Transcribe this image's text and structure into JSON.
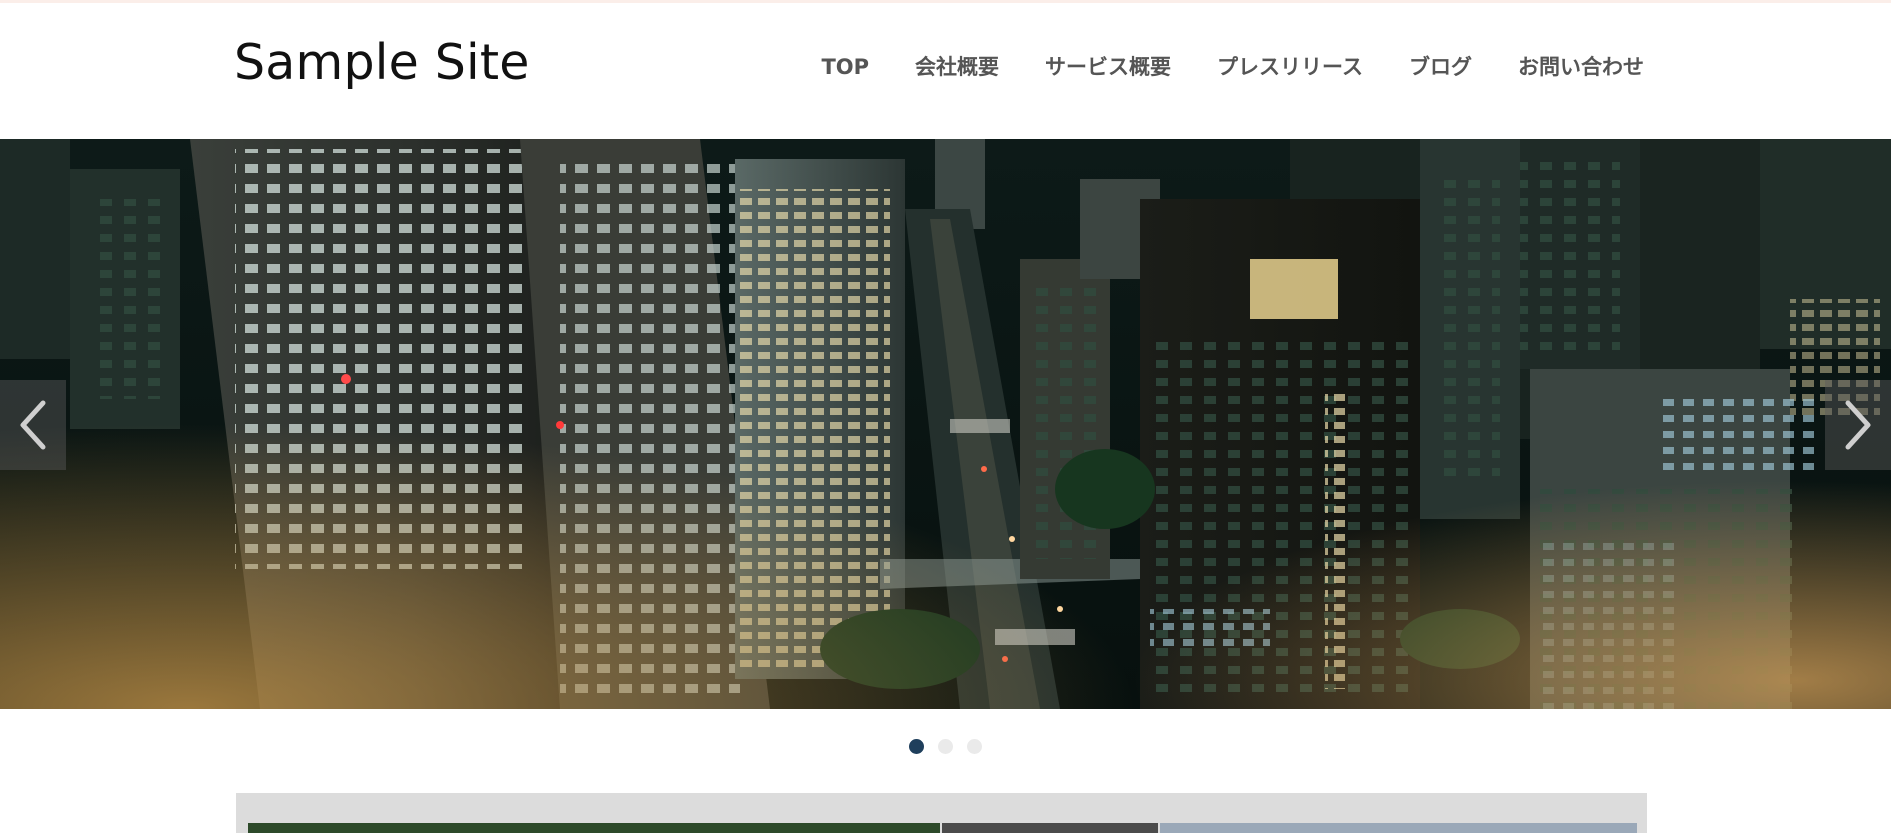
{
  "site": {
    "title": "Sample Site"
  },
  "nav": {
    "items": [
      {
        "label": "TOP"
      },
      {
        "label": "会社概要"
      },
      {
        "label": "サービス概要"
      },
      {
        "label": "プレスリリース"
      },
      {
        "label": "ブログ"
      },
      {
        "label": "お問い合わせ"
      }
    ]
  },
  "slider": {
    "image": "night-city-skyline-photo",
    "prev_icon": "chevron-left-icon",
    "next_icon": "chevron-right-icon",
    "slide_count": 3,
    "active_slide": 1
  },
  "colors": {
    "nav_text": "#555555",
    "active_dot": "#1f3f5c",
    "inactive_dot": "#eaeaea",
    "panel_bg": "#dcdcdc"
  }
}
